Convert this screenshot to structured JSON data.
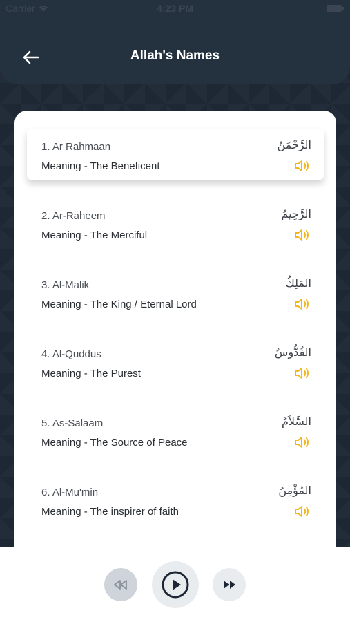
{
  "status_bar": {
    "carrier": "Carrier",
    "time": "4:23 PM"
  },
  "header": {
    "title": "Allah's Names",
    "back_icon": "arrow-left-icon"
  },
  "names": [
    {
      "name": "1. Ar Rahmaan",
      "meaning": "Meaning - The Beneficent",
      "arabic": "الرَّحْمَنُ",
      "active": true
    },
    {
      "name": "2. Ar-Raheem",
      "meaning": "Meaning - The Merciful",
      "arabic": "الرَّحِيمُ"
    },
    {
      "name": "3. Al-Malik",
      "meaning": "Meaning - The King / Eternal Lord",
      "arabic": "المَلِكُ"
    },
    {
      "name": "4. Al-Quddus",
      "meaning": "Meaning - The Purest",
      "arabic": "القُدُّوسُ"
    },
    {
      "name": "5. As-Salaam",
      "meaning": "Meaning - The Source of Peace",
      "arabic": "السَّلاَمُ"
    },
    {
      "name": "6. Al-Mu'min",
      "meaning": "Meaning - The inspirer of faith",
      "arabic": "المُؤْمِنُ"
    }
  ],
  "player": {
    "prev_icon": "rewind-icon",
    "play_icon": "play-icon",
    "next_icon": "fast-forward-icon"
  },
  "colors": {
    "background": "#1d2834",
    "header": "#243240",
    "accent_speaker": "#f2b71d",
    "card": "#ffffff"
  }
}
